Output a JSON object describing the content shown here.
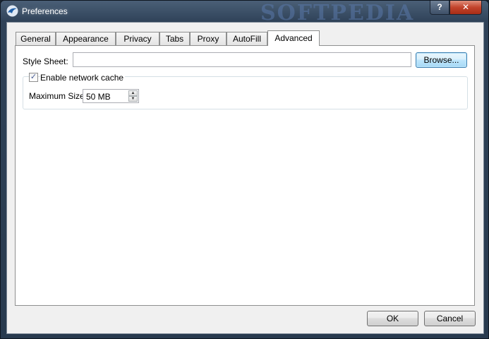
{
  "window": {
    "title": "Preferences",
    "watermark": "SOFTPEDIA",
    "help_label": "?",
    "close_label": "✕"
  },
  "tabs": [
    {
      "label": "General"
    },
    {
      "label": "Appearance"
    },
    {
      "label": "Privacy"
    },
    {
      "label": "Tabs"
    },
    {
      "label": "Proxy"
    },
    {
      "label": "AutoFill"
    },
    {
      "label": "Advanced",
      "active": true
    }
  ],
  "advanced": {
    "style_sheet_label": "Style Sheet:",
    "style_sheet_value": "",
    "browse_label": "Browse...",
    "cache_checkbox_label": "Enable network cache",
    "cache_checked": true,
    "max_size_label": "Maximum Size:",
    "max_size_value": "50 MB"
  },
  "footer": {
    "ok_label": "OK",
    "cancel_label": "Cancel"
  },
  "icons": {
    "app": "bird-app-icon",
    "check": "checkmark-icon",
    "spin_up": "arrow-up-icon",
    "spin_down": "arrow-down-icon"
  },
  "colors": {
    "titlebar": "#2f4258",
    "close_button": "#c2432b",
    "panel_bg": "#ffffff",
    "dialog_bg": "#f0f0f0",
    "default_button_border": "#3c7fb1"
  }
}
